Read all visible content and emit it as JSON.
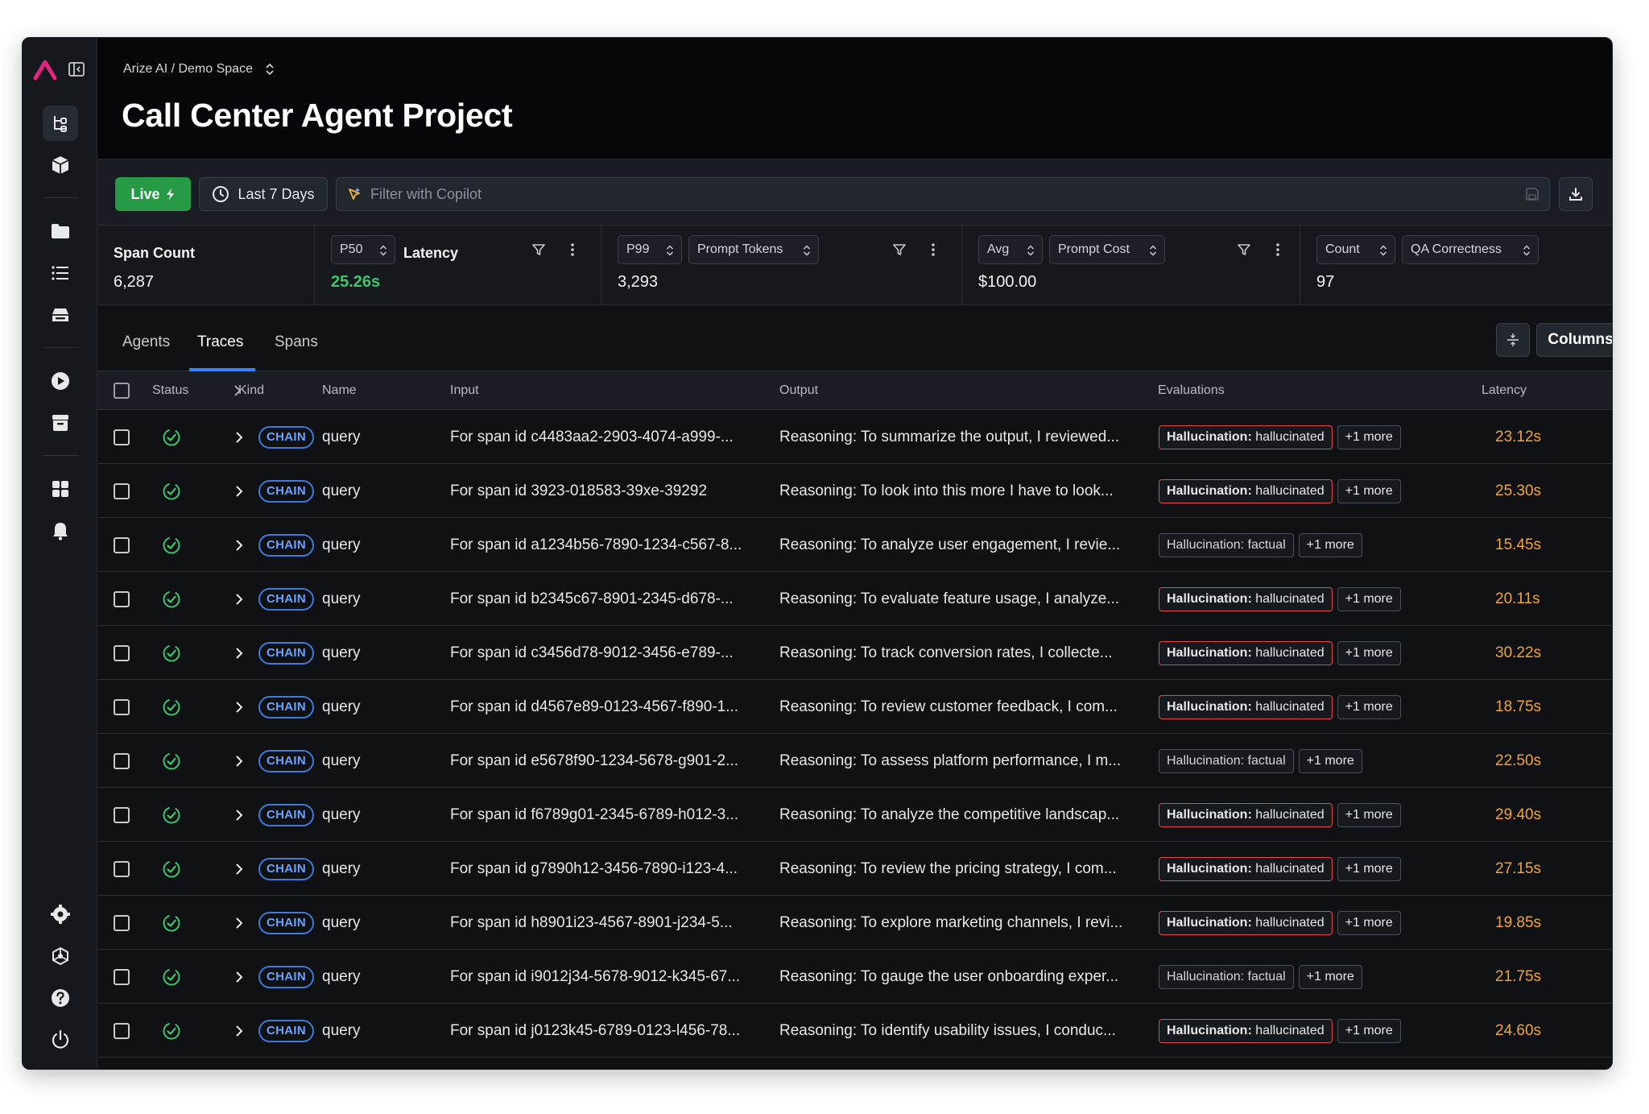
{
  "header": {
    "breadcrumb": "Arize AI / Demo Space",
    "title": "Call Center Agent Project"
  },
  "sidebar": {
    "items": [
      {
        "icon": "traces-icon"
      },
      {
        "icon": "cube-icon"
      },
      {
        "icon": "folder-icon"
      },
      {
        "icon": "list-icon"
      },
      {
        "icon": "dataset-icon"
      },
      {
        "icon": "play-icon"
      },
      {
        "icon": "archive-icon"
      },
      {
        "icon": "grid-icon"
      },
      {
        "icon": "bell-icon"
      },
      {
        "icon": "settings-icon"
      },
      {
        "icon": "integrations-icon"
      },
      {
        "icon": "help-icon"
      },
      {
        "icon": "power-icon"
      }
    ]
  },
  "filterbar": {
    "live_label": "Live",
    "time_range": "Last 7 Days",
    "copilot_placeholder": "Filter with Copilot"
  },
  "metrics": {
    "span_count": {
      "title": "Span Count",
      "value": "6,287"
    },
    "latency": {
      "percentile": "P50",
      "metric": "Latency",
      "value": "25.26s"
    },
    "prompt_tokens": {
      "percentile": "P99",
      "metric": "Prompt Tokens",
      "value": "3,293"
    },
    "prompt_cost": {
      "agg": "Avg",
      "metric": "Prompt Cost",
      "value": "$100.00"
    },
    "qa": {
      "agg": "Count",
      "metric": "QA Correctness",
      "value": "97"
    }
  },
  "tabs": {
    "agents": "Agents",
    "traces": "Traces",
    "spans": "Spans",
    "active": "Traces",
    "columns_label": "Columns"
  },
  "table": {
    "headers": {
      "status": "Status",
      "kind": "Kind",
      "name": "Name",
      "input": "Input",
      "output": "Output",
      "evaluations": "Evaluations",
      "latency": "Latency"
    },
    "rows": [
      {
        "kind": "CHAIN",
        "name": "query",
        "input": "For span id c4483aa2-2903-4074-a999-...",
        "output": "Reasoning: To summarize the output, I reviewed...",
        "eval_key": "Hallucination:",
        "eval_val": "hallucinated",
        "eval_type": "halluc",
        "more": "+1 more",
        "latency": "23.12s"
      },
      {
        "kind": "CHAIN",
        "name": "query",
        "input": "For span id 3923-018583-39xe-39292",
        "output": "Reasoning: To look into this more I have to look...",
        "eval_key": "Hallucination:",
        "eval_val": "hallucinated",
        "eval_type": "halluc",
        "more": "+1 more",
        "latency": "25.30s"
      },
      {
        "kind": "CHAIN",
        "name": "query",
        "input": "For span id a1234b56-7890-1234-c567-8...",
        "output": "Reasoning: To analyze user engagement, I revie...",
        "eval_key": "Hallucination:",
        "eval_val": "factual",
        "eval_type": "fact",
        "more": "+1 more",
        "latency": "15.45s"
      },
      {
        "kind": "CHAIN",
        "name": "query",
        "input": "For span id b2345c67-8901-2345-d678-...",
        "output": "Reasoning: To evaluate feature usage, I analyze...",
        "eval_key": "Hallucination:",
        "eval_val": "hallucinated",
        "eval_type": "halluc",
        "more": "+1 more",
        "latency": "20.11s"
      },
      {
        "kind": "CHAIN",
        "name": "query",
        "input": "For span id c3456d78-9012-3456-e789-...",
        "output": "Reasoning: To track conversion rates, I collecte...",
        "eval_key": "Hallucination:",
        "eval_val": "hallucinated",
        "eval_type": "halluc",
        "more": "+1 more",
        "latency": "30.22s"
      },
      {
        "kind": "CHAIN",
        "name": "query",
        "input": "For span id d4567e89-0123-4567-f890-1...",
        "output": "Reasoning: To review customer feedback, I com...",
        "eval_key": "Hallucination:",
        "eval_val": "hallucinated",
        "eval_type": "halluc",
        "more": "+1 more",
        "latency": "18.75s"
      },
      {
        "kind": "CHAIN",
        "name": "query",
        "input": "For span id e5678f90-1234-5678-g901-2...",
        "output": "Reasoning: To assess platform performance, I m...",
        "eval_key": "Hallucination:",
        "eval_val": "factual",
        "eval_type": "fact",
        "more": "+1 more",
        "latency": "22.50s"
      },
      {
        "kind": "CHAIN",
        "name": "query",
        "input": "For span id f6789g01-2345-6789-h012-3...",
        "output": "Reasoning: To analyze the competitive landscap...",
        "eval_key": "Hallucination:",
        "eval_val": "hallucinated",
        "eval_type": "halluc",
        "more": "+1 more",
        "latency": "29.40s"
      },
      {
        "kind": "CHAIN",
        "name": "query",
        "input": "For span id g7890h12-3456-7890-i123-4...",
        "output": "Reasoning: To review the pricing strategy, I com...",
        "eval_key": "Hallucination:",
        "eval_val": "hallucinated",
        "eval_type": "halluc",
        "more": "+1 more",
        "latency": "27.15s"
      },
      {
        "kind": "CHAIN",
        "name": "query",
        "input": "For span id h8901i23-4567-8901-j234-5...",
        "output": "Reasoning: To explore marketing channels, I revi...",
        "eval_key": "Hallucination:",
        "eval_val": "hallucinated",
        "eval_type": "halluc",
        "more": "+1 more",
        "latency": "19.85s"
      },
      {
        "kind": "CHAIN",
        "name": "query",
        "input": "For span id i9012j34-5678-9012-k345-67...",
        "output": "Reasoning: To gauge the user onboarding exper...",
        "eval_key": "Hallucination:",
        "eval_val": "factual",
        "eval_type": "fact",
        "more": "+1 more",
        "latency": "21.75s"
      },
      {
        "kind": "CHAIN",
        "name": "query",
        "input": "For span id j0123k45-6789-0123-l456-78...",
        "output": "Reasoning: To identify usability issues, I conduc...",
        "eval_key": "Hallucination:",
        "eval_val": "hallucinated",
        "eval_type": "halluc",
        "more": "+1 more",
        "latency": "24.60s"
      }
    ]
  },
  "colors": {
    "accent_green": "#279a45",
    "latency_green": "#3ec46d",
    "kind_blue": "#3f7ad6",
    "hallucination_red": "#e5484d",
    "latency_orange": "#f0a53a",
    "logo_pink": "#e4257f"
  }
}
